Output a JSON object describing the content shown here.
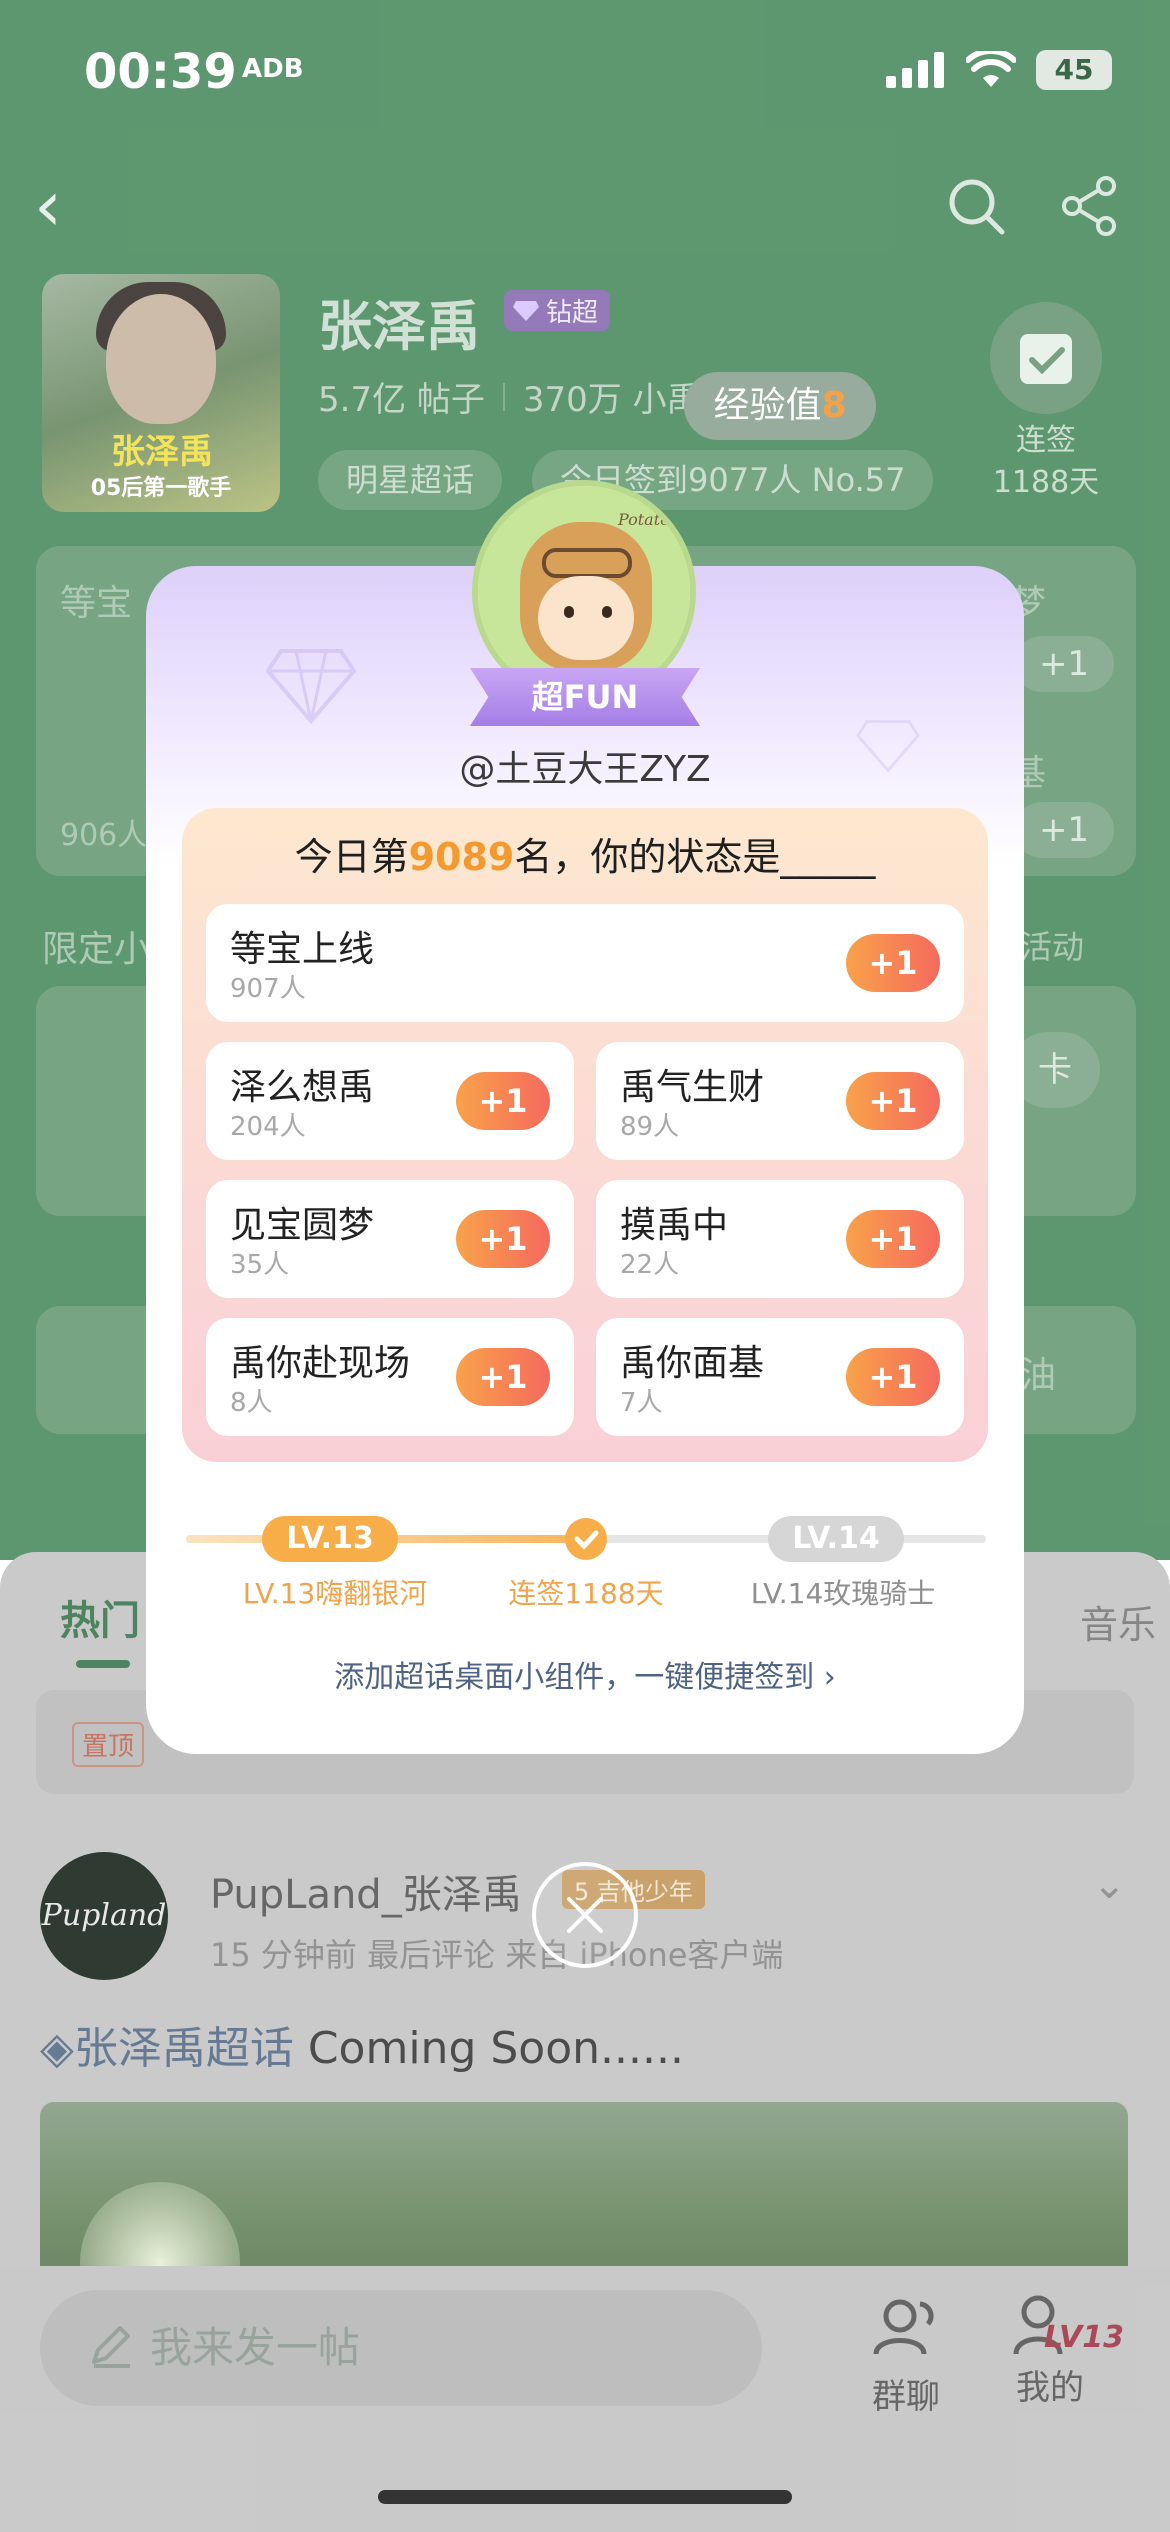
{
  "status_bar": {
    "time": "00:39",
    "tag": "ADB",
    "battery": "45"
  },
  "header": {
    "star_name": "张泽禹",
    "badge": "钻超",
    "posts": "5.7亿 帖子",
    "members": "370万 小禹宝",
    "exp_label": "经验值",
    "exp_value": "8",
    "tag_star": "明星超话",
    "tag_checkin": "今日签到9077人 No.57",
    "checkin_label": "连签",
    "checkin_days": "1188天",
    "cover_text_1": "张泽禹",
    "cover_text_2": "05后第一歌手"
  },
  "background_cards": {
    "left_title": "等宝",
    "left_count": "906人",
    "right_title_1": "梦",
    "right_title_2": "基",
    "plus": "+1",
    "limited": "限定小",
    "activity": "活动",
    "card_btn": "卡",
    "oil": "油"
  },
  "feed": {
    "tab_hot": "热门",
    "tab_music": "音乐",
    "pinned_tag": "置顶",
    "post_user": "PupLand_张泽禹",
    "post_level": "吉他少年",
    "post_level_num": "5",
    "post_meta": "15 分钟前 最后评论 来自 iPhone客户端",
    "post_topic": "张泽禹超话",
    "post_text": " Coming Soon......",
    "avatar_text": "Pupland"
  },
  "bottom_bar": {
    "compose_placeholder": "我来发一帖",
    "group_chat": "群聊",
    "mine": "我的",
    "level_badge": "LV13"
  },
  "popup": {
    "fun_ribbon": "超FUN",
    "handle": "@土豆大王ZYZ",
    "avatar_label": "Potato",
    "rank_prefix": "今日第",
    "rank_number": "9089",
    "rank_suffix": "名，你的状态是_____",
    "options": [
      {
        "name": "等宝上线",
        "count": "907人",
        "plus": "+1"
      },
      {
        "name": "泽么想禹",
        "count": "204人",
        "plus": "+1"
      },
      {
        "name": "禹气生财",
        "count": "89人",
        "plus": "+1"
      },
      {
        "name": "见宝圆梦",
        "count": "35人",
        "plus": "+1"
      },
      {
        "name": "摸禹中",
        "count": "22人",
        "plus": "+1"
      },
      {
        "name": "禹你赴现场",
        "count": "8人",
        "plus": "+1"
      },
      {
        "name": "禹你面基",
        "count": "7人",
        "plus": "+1"
      }
    ],
    "level": {
      "current_pill": "LV.13",
      "next_pill": "LV.14",
      "current_label": "LV.13嗨翻银河",
      "streak_label": "连签1188天",
      "next_label": "LV.14玫瑰骑士",
      "progress_fraction": 0.5
    },
    "widget_link": "添加超话桌面小组件，一键便捷签到",
    "colors": {
      "accent_orange": "#f39a2f",
      "plus_from": "#f9a24a",
      "plus_to": "#f56a5e",
      "ribbon_purple": "#a57ee6"
    }
  }
}
